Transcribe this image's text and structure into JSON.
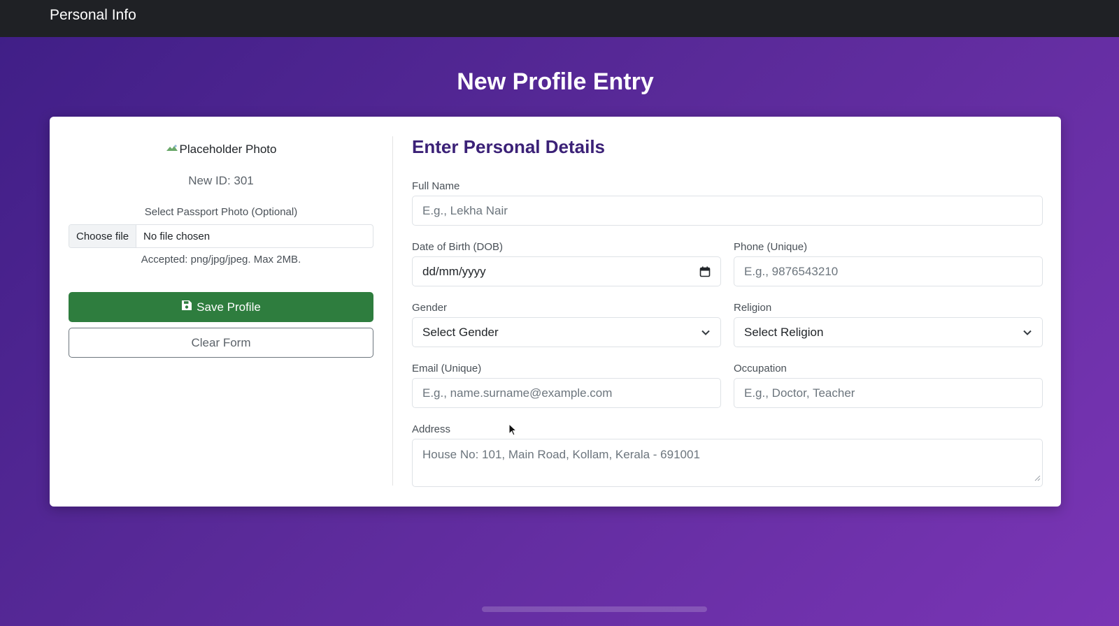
{
  "nav": {
    "brand": "Personal Info"
  },
  "page": {
    "title": "New Profile Entry"
  },
  "left": {
    "photo_alt": "Placeholder Photo",
    "new_id": "New ID: 301",
    "select_photo_label": "Select Passport Photo (Optional)",
    "file_button": "Choose file",
    "file_status": "No file chosen",
    "accepted_note": "Accepted: png/jpg/jpeg. Max 2MB.",
    "save_label": "Save Profile",
    "clear_label": "Clear Form"
  },
  "form": {
    "title": "Enter Personal Details",
    "full_name": {
      "label": "Full Name",
      "placeholder": "E.g., Lekha Nair"
    },
    "dob": {
      "label": "Date of Birth (DOB)",
      "value": "dd/mm/yyyy"
    },
    "phone": {
      "label": "Phone (Unique)",
      "placeholder": "E.g., 9876543210"
    },
    "gender": {
      "label": "Gender",
      "selected": "Select Gender"
    },
    "religion": {
      "label": "Religion",
      "selected": "Select Religion"
    },
    "email": {
      "label": "Email (Unique)",
      "placeholder": "E.g., name.surname@example.com"
    },
    "occupation": {
      "label": "Occupation",
      "placeholder": "E.g., Doctor, Teacher"
    },
    "address": {
      "label": "Address",
      "placeholder": "House No: 101, Main Road, Kollam, Kerala - 691001"
    }
  },
  "icons": {
    "save": "floppy-disk-icon",
    "calendar": "calendar-icon",
    "chevron": "chevron-down-icon",
    "broken_image": "broken-image-icon"
  },
  "colors": {
    "navbar": "#1f2125",
    "save_button": "#2e7d3e",
    "section_title": "#3b2177",
    "background_start": "#3f1e86",
    "background_end": "#7a35b5"
  }
}
